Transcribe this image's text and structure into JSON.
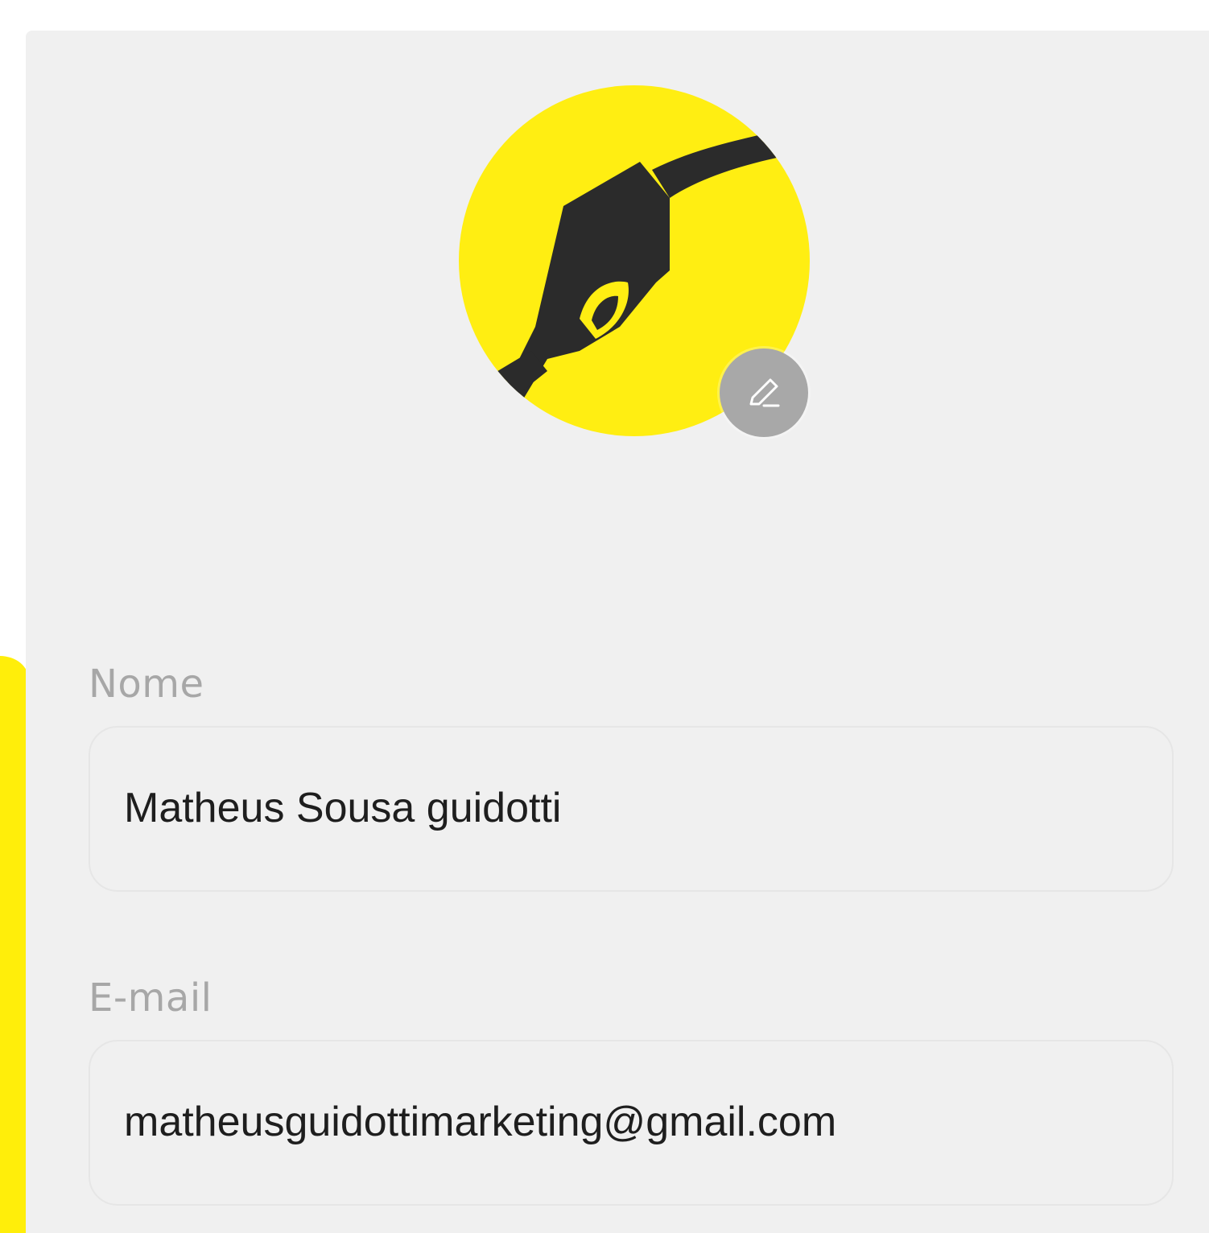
{
  "profile": {
    "avatar": {
      "image_icon": "fuel-nozzle-icon",
      "background_color": "#FFEE12",
      "edit_icon": "pencil-icon"
    },
    "fields": {
      "name": {
        "label": "Nome",
        "value": "Matheus Sousa guidotti"
      },
      "email": {
        "label": "E-mail",
        "value": "matheusguidottimarketing@gmail.com"
      }
    }
  },
  "colors": {
    "accent": "#FFEE0A",
    "panel_bg": "#F0F0F0",
    "label": "#A7A7A7",
    "value": "#1E1E1E",
    "edit_button": "#A8A8A8"
  }
}
